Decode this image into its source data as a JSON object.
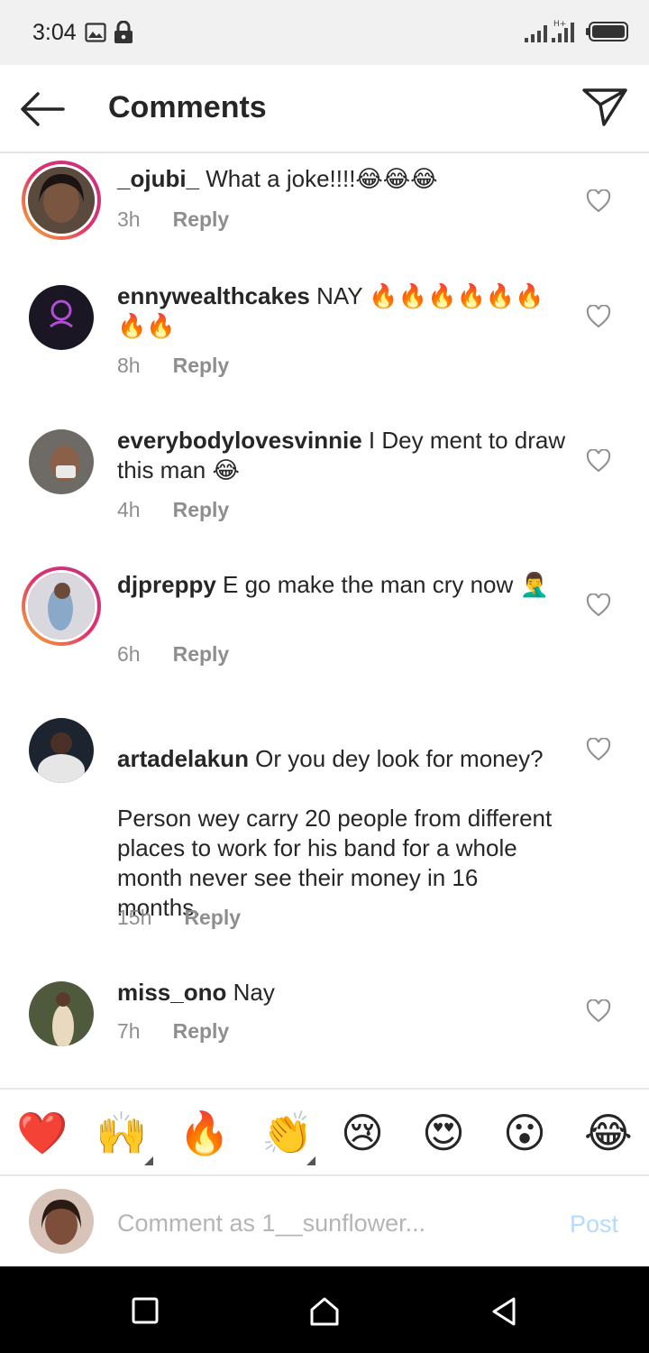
{
  "status_bar": {
    "time": "3:04",
    "left_icons": [
      "image-icon",
      "lock-icon"
    ],
    "right_icons": [
      "signal-icon",
      "signal-icon",
      "battery-icon"
    ]
  },
  "header": {
    "title": "Comments",
    "back_icon": "back-arrow-icon",
    "share_icon": "send-icon"
  },
  "comments": [
    {
      "username": "_ojubi_",
      "text": " What a joke!!!!😂😂😂",
      "time": "3h",
      "reply": "Reply",
      "story_ring": true
    },
    {
      "username": "ennywealthcakes",
      "text": " NAY 🔥🔥🔥🔥🔥🔥🔥🔥",
      "time": "8h",
      "reply": "Reply",
      "story_ring": false
    },
    {
      "username": "everybodylovesvinnie",
      "text": " I Dey ment to draw this man 😂",
      "time": "4h",
      "reply": "Reply",
      "story_ring": false
    },
    {
      "username": "djpreppy",
      "text": " E go make the man cry now 🤦‍♂️",
      "time": "6h",
      "reply": "Reply",
      "story_ring": true
    },
    {
      "username": "artadelakun",
      "text": " Or you dey look for money?\n\nPerson wey carry 20 people from different places to work for his band for a whole month never see their money in 16 months.",
      "time": "15h",
      "reply": "Reply",
      "story_ring": false
    },
    {
      "username": "miss_ono",
      "text": " Nay",
      "time": "7h",
      "reply": "Reply",
      "story_ring": false
    }
  ],
  "emoji_bar": [
    "❤️",
    "🙌",
    "🔥",
    "👏",
    "😢",
    "😍",
    "😮",
    "😂"
  ],
  "composer": {
    "placeholder": "Comment as 1__sunflower...",
    "post_label": "Post"
  },
  "colors": {
    "post_disabled": "#b3dbff",
    "muted": "#8e8e8e",
    "story_ring_start": "#f7b42c",
    "story_ring_end": "#c13584"
  }
}
